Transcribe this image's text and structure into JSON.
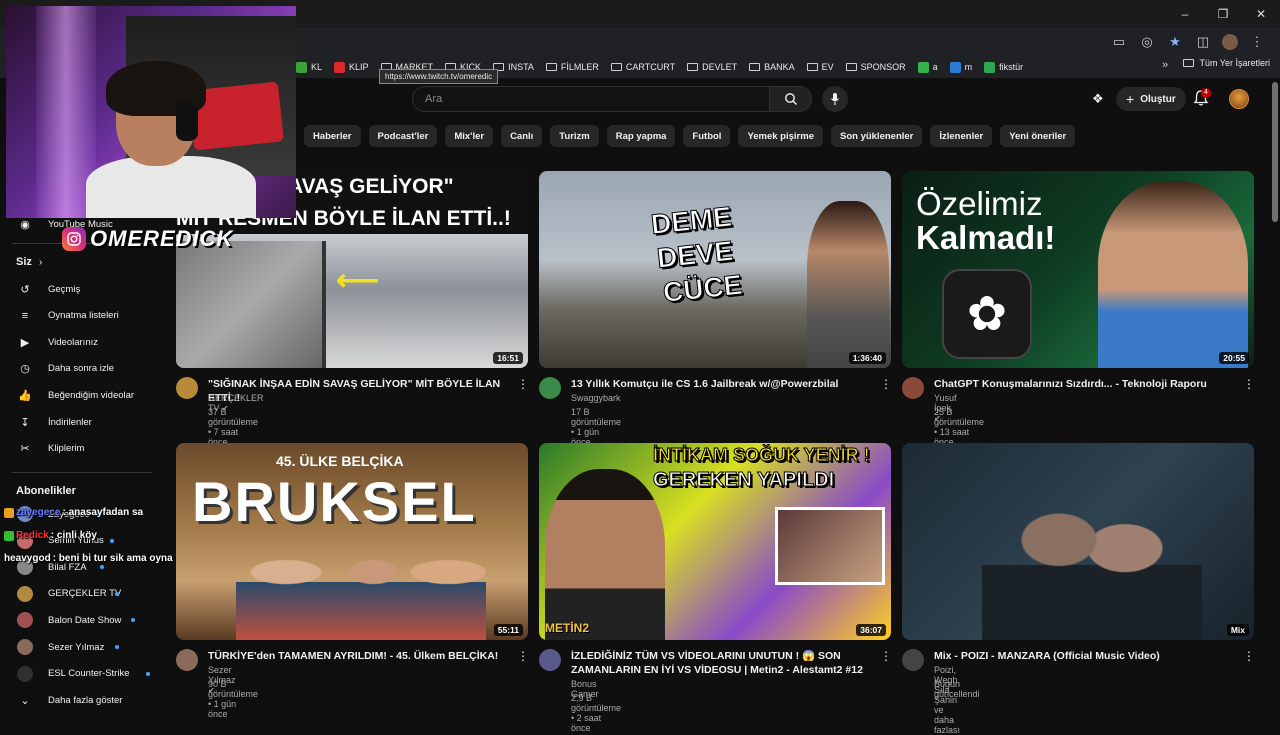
{
  "browser": {
    "url_tooltip": "https://www.twitch.tv/omeredic",
    "bookmarks": [
      {
        "label": "KL",
        "color": "#3aa335"
      },
      {
        "label": "KLIP",
        "color": "#d92b2b"
      },
      {
        "label": "MARKET",
        "folder": true
      },
      {
        "label": "KICK",
        "folder": true
      },
      {
        "label": "INSTA",
        "folder": true
      },
      {
        "label": "FİLMLER",
        "folder": true
      },
      {
        "label": "CARTCURT",
        "folder": true
      },
      {
        "label": "DEVLET",
        "folder": true
      },
      {
        "label": "BANKA",
        "folder": true
      },
      {
        "label": "EV",
        "folder": true
      },
      {
        "label": "SPONSOR",
        "folder": true
      },
      {
        "label": "a",
        "color": "#33b24a"
      },
      {
        "label": "m",
        "color": "#2a7bd8"
      },
      {
        "label": "fikstür",
        "color": "#2fa84f"
      }
    ],
    "all_bookmarks": "Tüm Yer İşaretleri"
  },
  "header": {
    "search_placeholder": "Ara",
    "create_label": "Oluştur",
    "notification_count": "4"
  },
  "chips": [
    "ik",
    "Haberler",
    "Podcast'ler",
    "Mix'ler",
    "Canlı",
    "Turizm",
    "Rap yapma",
    "Futbol",
    "Yemek pişirme",
    "Son yüklenenler",
    "İzlenenler",
    "Yeni öneriler"
  ],
  "sidebar": {
    "partial_item": "YouTube Music",
    "you_heading": "Siz",
    "you_items": [
      {
        "label": "Geçmiş",
        "icon": "history-icon"
      },
      {
        "label": "Oynatma listeleri",
        "icon": "playlist-icon"
      },
      {
        "label": "Videolarınız",
        "icon": "your-videos-icon"
      },
      {
        "label": "Daha sonra izle",
        "icon": "watch-later-icon"
      },
      {
        "label": "Beğendiğim videolar",
        "icon": "like-icon"
      },
      {
        "label": "İndirilenler",
        "icon": "download-icon"
      },
      {
        "label": "Kliplerim",
        "icon": "clips-icon"
      }
    ],
    "subs_heading": "Abonelikler",
    "subs": [
      {
        "label": "Zayegece",
        "color": "#6a8ac8"
      },
      {
        "label": "Semih Yunus",
        "color": "#c86a6a"
      },
      {
        "label": "Bilal FZA",
        "color": "#888888"
      },
      {
        "label": "GERÇEKLER TV",
        "color": "#b08a40"
      },
      {
        "label": "Balon Date Show",
        "color": "#a05050"
      },
      {
        "label": "Sezer Yılmaz",
        "color": "#8a6a5a"
      },
      {
        "label": "ESL Counter-Strike",
        "color": "#303030"
      }
    ],
    "more_label": "Daha fazla göster"
  },
  "chat": [
    {
      "user": "zayegece",
      "text": ": anasayfadan sa",
      "user_color": "#6a7aff",
      "badge": "#e8a020"
    },
    {
      "user": "Redick",
      "text": ": cinli köy",
      "user_color": "#ff3030",
      "badge": "#30c030"
    },
    {
      "user": "heavygod",
      "text": ": beni bi tur sik ama oyna",
      "user_color": "#ffffff",
      "badge": ""
    }
  ],
  "webcam": {
    "watermark": "OMEREDICK"
  },
  "videos": [
    {
      "title": "\"SIĞINAK İNŞAA EDİN SAVAŞ GELİYOR\" MİT BÖYLE İLAN ETTİ..!",
      "channel": "GERÇEKLER TV",
      "verified": true,
      "meta": "37 B görüntüleme • 7 saat önce",
      "duration": "16:51",
      "thumb_lines": [
        "\"YAPIN SAVAŞ GELİYOR\"",
        "MİT RESMEN BÖYLE İLAN ETTİ..!"
      ]
    },
    {
      "title": "13 Yıllık Komutçu ile CS 1.6 Jailbreak w/@Powerzbilal",
      "channel": "Swaggybark",
      "verified": false,
      "meta": "17 B görüntüleme • 1 gün önce",
      "duration": "1:36:40",
      "thumb_lines": [
        "DEME",
        "DEVE",
        "CÜCE"
      ]
    },
    {
      "title": "ChatGPT Konuşmalarınızı Sızdırdı... - Teknoloji Raporu",
      "channel": "Yusuf İpek",
      "verified": true,
      "meta": "25 B görüntüleme • 13 saat önce",
      "duration": "20:55",
      "thumb_lines": [
        "Özelimiz",
        "Kalmadı!"
      ]
    },
    {
      "title": "TÜRKİYE'den TAMAMEN AYRILDIM! - 45. Ülkem BELÇİKA!",
      "channel": "Sezer Yılmaz",
      "verified": true,
      "meta": "90 B görüntüleme • 1 gün önce",
      "duration": "55:11",
      "thumb_lines": [
        "45. ÜLKE BELÇİKA",
        "BRUKSEL"
      ]
    },
    {
      "title": "İZLEDİĞİNİZ TÜM VS VİDEOLARINI UNUTUN ! 😱 SON ZAMANLARIN EN İYİ VS VİDEOSU | Metin2 - Alestamt2 #12",
      "channel": "Bonus Gamer",
      "verified": false,
      "meta": "2,9 B görüntüleme • 2 saat önce",
      "duration": "36:07",
      "thumb_lines": [
        "İNTİKAM SOĞUK YENİR !",
        "GEREKEN YAPILDI",
        "METİN2"
      ]
    },
    {
      "title": "Mix - POIZI - MANZARA (Official Music Video)",
      "channel": "Poizi, Wegh, Sıla Şahin ve daha fazlası",
      "verified": false,
      "meta": "Bugün güncellendi",
      "duration": "Mix",
      "thumb_lines": []
    }
  ]
}
